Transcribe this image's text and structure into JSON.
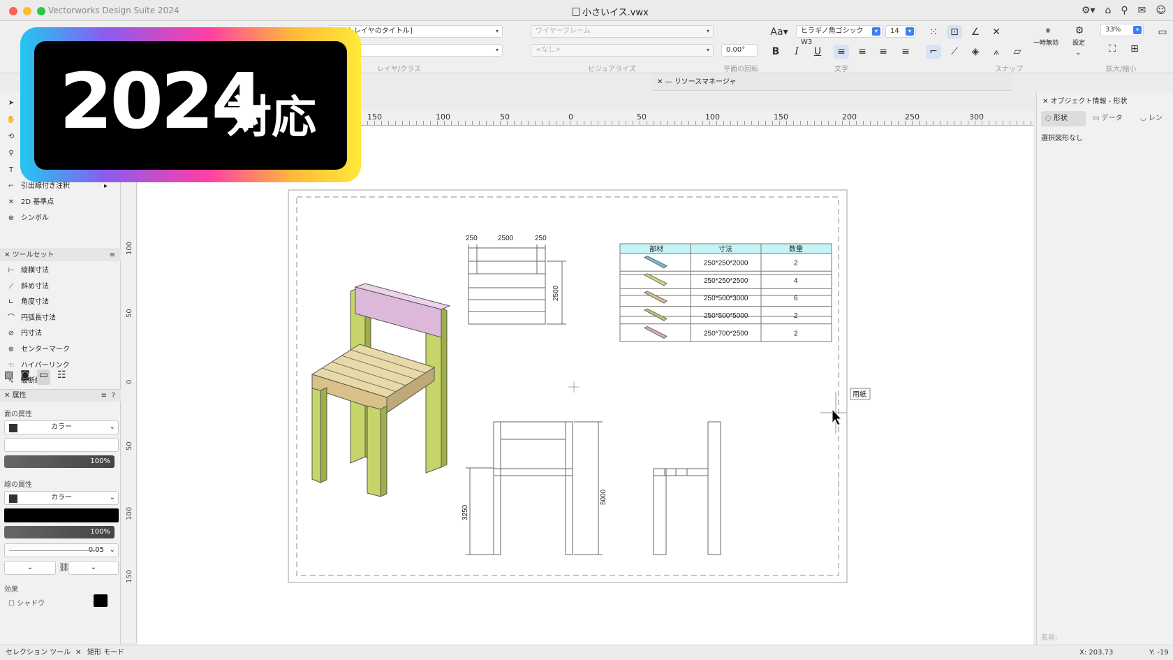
{
  "window": {
    "app_title": "Vectorworks Design Suite 2024",
    "doc_title": "小さいイス.vwx"
  },
  "toolbar": {
    "layer_dropdown": "シートレイヤのタイトル]",
    "layer_label": "レイヤ/クラス",
    "render_dropdown": "ワイヤーフレーム",
    "render_sub": "<なし>",
    "visualize_label": "ビジュアライズ",
    "rotation_value": "0.00°",
    "rotation_label": "平面の回転",
    "font_name": "ヒラギノ角ゴシック W3",
    "font_size": "14",
    "text_label": "文字",
    "snap_label": "スナップ",
    "pause_label": "一時無効",
    "settings_label": "設定",
    "zoom_value": "33%",
    "zoom_label": "拡大/縮小"
  },
  "resource_manager": {
    "title": "リソースマネージャ"
  },
  "left_tools": [
    {
      "label": "文字",
      "icon": "text-tool-icon",
      "glyph": "T"
    },
    {
      "label": "引出線付き注釈",
      "icon": "callout-icon",
      "glyph": "⌐"
    },
    {
      "label": "2D 基準点",
      "icon": "locus-icon",
      "glyph": "✕"
    },
    {
      "label": "シンボル",
      "icon": "symbol-icon",
      "glyph": "⊕"
    }
  ],
  "toolset": {
    "title": "ツールセット",
    "items": [
      {
        "label": "縦横寸法",
        "icon": "constrained-dimension-icon",
        "glyph": "⊢"
      },
      {
        "label": "斜め寸法",
        "icon": "unconstrained-dimension-icon",
        "glyph": "⟋"
      },
      {
        "label": "角度寸法",
        "icon": "angular-dimension-icon",
        "glyph": "∟"
      },
      {
        "label": "円弧長寸法",
        "icon": "arc-length-dimension-icon",
        "glyph": "⌒"
      },
      {
        "label": "円寸法",
        "icon": "radial-dimension-icon",
        "glyph": "⊘"
      },
      {
        "label": "センターマーク",
        "icon": "center-mark-icon",
        "glyph": "⊕"
      },
      {
        "label": "ハイパーリンク",
        "icon": "hyperlink-icon",
        "glyph": "☜"
      },
      {
        "label": "破断線",
        "icon": "break-line-icon",
        "glyph": "∿"
      }
    ]
  },
  "attributes": {
    "title": "属性",
    "fill_label": "面の属性",
    "fill_type": "カラー",
    "fill_opacity": "100%",
    "line_label": "線の属性",
    "line_type": "カラー",
    "line_opacity": "100%",
    "line_weight": "0.05",
    "effects_label": "効果",
    "shadow_label": "シャドウ"
  },
  "rulers": {
    "horizontal": [
      "150",
      "100",
      "50",
      "0",
      "50",
      "100",
      "150",
      "200",
      "250",
      "300"
    ],
    "vertical": [
      "100",
      "50",
      "0",
      "50",
      "100",
      "150"
    ]
  },
  "object_info": {
    "title": "オブジェクト情報 - 形状",
    "tab_shape": "形状",
    "tab_data": "データ",
    "tab_render": "レン",
    "empty_text": "選択図形なし",
    "name_label": "名前:"
  },
  "drawing": {
    "tooltip": "用紙",
    "table_headers": [
      "部材",
      "寸法",
      "数量"
    ],
    "table_rows": [
      {
        "size": "250*250*2000",
        "qty": "2",
        "color": "#6fbfd6"
      },
      {
        "size": "250*250*2500",
        "qty": "4",
        "color": "#d2dc6a"
      },
      {
        "size": "250*500*3000",
        "qty": "6",
        "color": "#dcc48a"
      },
      {
        "size": "250*500*5000",
        "qty": "2",
        "color": "#b8c96a"
      },
      {
        "size": "250*700*2500",
        "qty": "2",
        "color": "#d9a9cf"
      }
    ],
    "dim_top": [
      "250",
      "2500",
      "250"
    ],
    "dim_right_top": "2500",
    "dim_left_front": "3250",
    "dim_right_front": "5000"
  },
  "status": {
    "tool": "セレクション ツール",
    "mode": "矩形 モード",
    "x": "X: 203.73",
    "y": "Y: -19"
  },
  "banner": {
    "year": "2024",
    "text": "対応"
  }
}
